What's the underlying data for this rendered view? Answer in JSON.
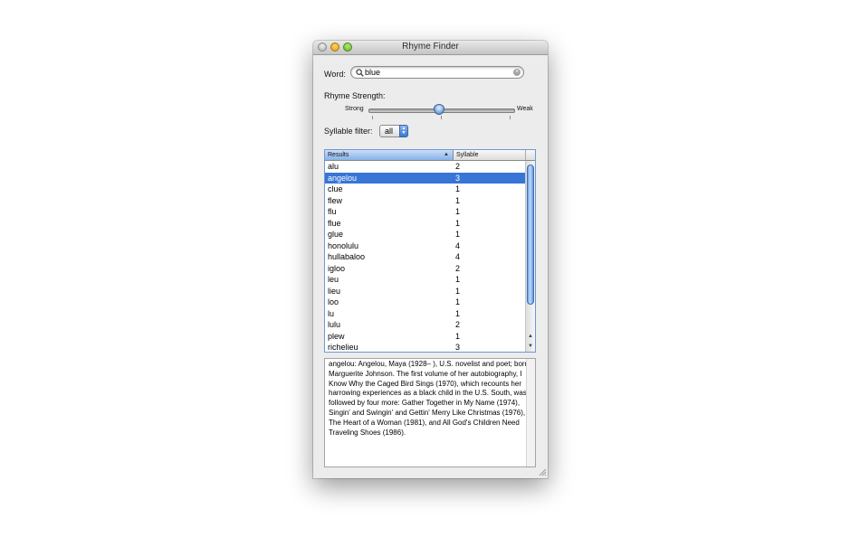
{
  "window": {
    "title": "Rhyme Finder"
  },
  "word": {
    "label": "Word:",
    "value": "blue"
  },
  "strength": {
    "label": "Rhyme Strength:",
    "min_label": "Strong",
    "max_label": "Weak",
    "level_fraction": 0.49
  },
  "syllable": {
    "label": "Syllable filter:",
    "selected": "all"
  },
  "table": {
    "headers": [
      "Results",
      "Syllable"
    ],
    "selected_index": 1,
    "rows": [
      {
        "word": "alu",
        "syllables": "2"
      },
      {
        "word": "angelou",
        "syllables": "3"
      },
      {
        "word": "clue",
        "syllables": "1"
      },
      {
        "word": "flew",
        "syllables": "1"
      },
      {
        "word": "flu",
        "syllables": "1"
      },
      {
        "word": "flue",
        "syllables": "1"
      },
      {
        "word": "glue",
        "syllables": "1"
      },
      {
        "word": "honolulu",
        "syllables": "4"
      },
      {
        "word": "hullabaloo",
        "syllables": "4"
      },
      {
        "word": "igloo",
        "syllables": "2"
      },
      {
        "word": "leu",
        "syllables": "1"
      },
      {
        "word": "lieu",
        "syllables": "1"
      },
      {
        "word": "loo",
        "syllables": "1"
      },
      {
        "word": "lu",
        "syllables": "1"
      },
      {
        "word": "lulu",
        "syllables": "2"
      },
      {
        "word": "plew",
        "syllables": "1"
      },
      {
        "word": "richelieu",
        "syllables": "3"
      }
    ]
  },
  "definition": "angelou:    Angelou, Maya (1928– ), U.S. novelist and poet; born Marguerite Johnson. The first volume of her autobiography, I Know Why the Caged Bird Sings (1970), which recounts her harrowing experiences as a black child in the U.S. South, was followed by four more: Gather Together in My Name (1974), Singin' and Swingin' and Gettin' Merry Like Christmas (1976), The Heart of a Woman (1981), and All God's Children Need Traveling Shoes (1986).",
  "colors": {
    "selection": "#3875d7",
    "accent": "#6f98d6"
  }
}
